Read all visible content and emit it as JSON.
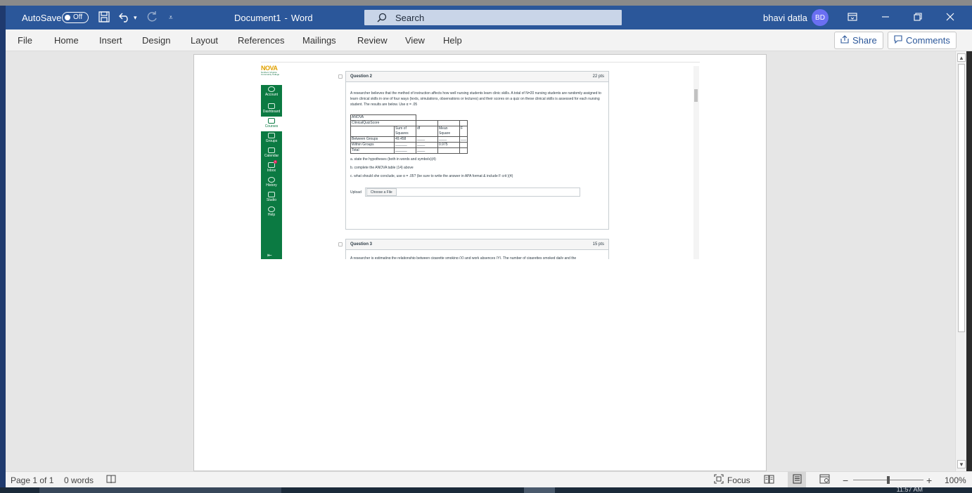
{
  "window": {
    "autosave_label": "AutoSave",
    "autosave_state": "Off",
    "doc_title": "Document1",
    "separator": "-",
    "app_name": "Word",
    "search_placeholder": "Search",
    "user_name": "bhavi datla",
    "user_initials": "BD",
    "accent_color": "#2b579a"
  },
  "ribbon": {
    "tabs": [
      "File",
      "Home",
      "Insert",
      "Design",
      "Layout",
      "References",
      "Mailings",
      "Review",
      "View",
      "Help"
    ],
    "share_label": "Share",
    "comments_label": "Comments"
  },
  "embedded_page": {
    "logo_text": "NOVA",
    "logo_subtext": "Northern Virginia Community College",
    "nav_items": [
      "Account",
      "Dashboard",
      "Courses",
      "Groups",
      "Calendar",
      "Inbox",
      "History",
      "Studio",
      "Help"
    ],
    "inbox_badge": "1",
    "question2": {
      "title": "Question 2",
      "points": "22 pts",
      "prompt": "A researcher believes that the method of instruction affects how well nursing students learn clinic skills.  A total of N=20 nursing students are randomly assigned to learn clinical skills in one of four ways (texts, simulations, observations or lectures) and their scores on a quiz on these clinical skills is assessed for each nursing student. The results are below. Use α = .05",
      "table": {
        "title": "ANOVA",
        "subtitle": "ClinicalQuizScore",
        "headers": [
          "",
          "Sum of Squares",
          "df",
          "Mean Square",
          "F"
        ],
        "rows": [
          [
            "Between Groups",
            "49.458",
            "____",
            "____",
            "___"
          ],
          [
            "Within Groups",
            "______",
            "____",
            "0.975",
            ""
          ],
          [
            "Total",
            "______",
            "____",
            "",
            ""
          ]
        ]
      },
      "part_a": "a. state the hypotheses (both in words and symbols)(4)",
      "part_b": "b. complete the ANOVA table (14) above",
      "part_c": "c. what should she conclude, use α = .05? (be sure to write the answer in APA format & include F crit )(4)",
      "upload_label": "Upload",
      "choose_file_label": "Choose a File"
    },
    "question3": {
      "title": "Question 3",
      "points": "15 pts",
      "prompt_cut": "A researcher is estimating the relationship between cigarette smoking (X) and work absences (Y). The number of cigarettes smoked daily and the"
    }
  },
  "statusbar": {
    "page_info": "Page 1 of 1",
    "word_count": "0 words",
    "focus_label": "Focus",
    "zoom_minus": "−",
    "zoom_plus": "+",
    "zoom_level": "100%",
    "zoom_fraction": 0.5
  },
  "taskbar": {
    "clock": "11:57 AM"
  }
}
